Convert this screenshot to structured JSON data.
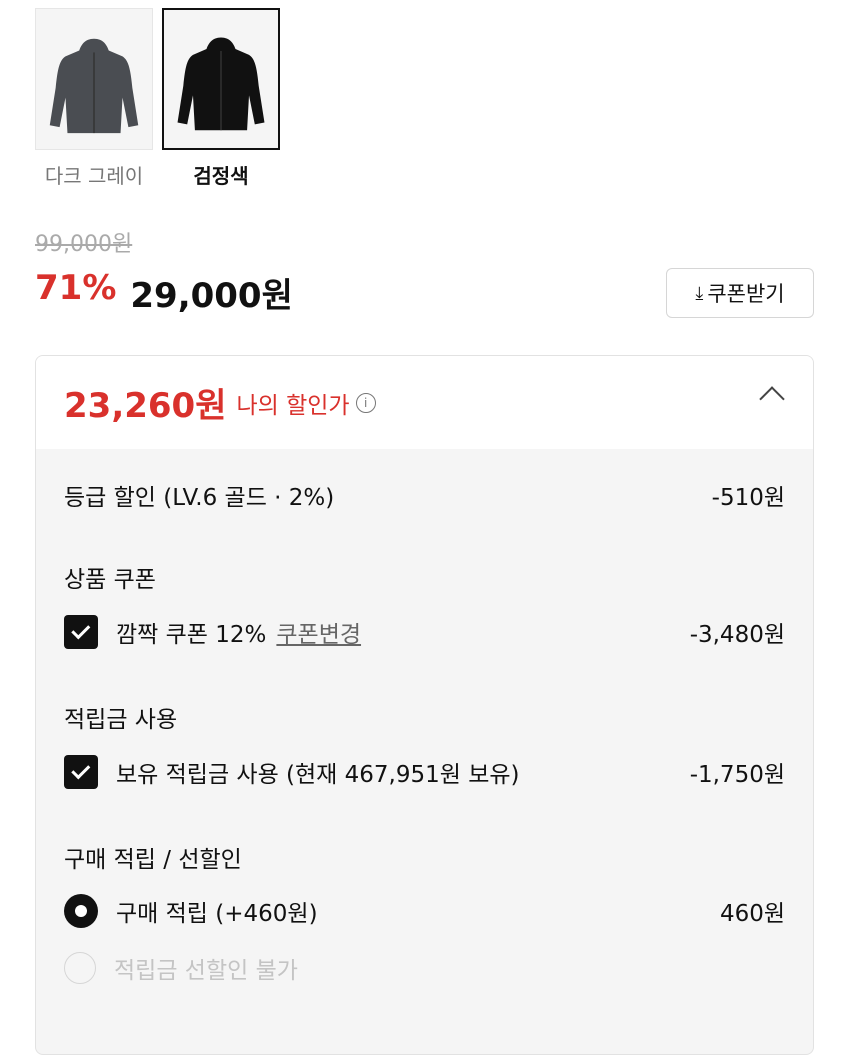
{
  "colors": {
    "swatches": [
      {
        "label": "다크 그레이",
        "color": "#4a4d52"
      },
      {
        "label": "검정색",
        "color": "#111111"
      }
    ]
  },
  "price": {
    "original": "99,000원",
    "discount_rate": "71%",
    "sale": "29,000원",
    "accent": "#d9312c"
  },
  "coupon_button": {
    "label": "쿠폰받기",
    "icon": "download-icon"
  },
  "my_discount": {
    "price": "23,260원",
    "label": "나의 할인가",
    "info_icon": "info-icon",
    "toggle_icon": "chevron-up-icon",
    "grade_discount": {
      "label": "등급 할인 (LV.6 골드 · 2%)",
      "amount": "-510원"
    },
    "product_coupon": {
      "title": "상품 쿠폰",
      "option_label": "깜짝 쿠폰 12%",
      "change_link": "쿠폰변경",
      "amount": "-3,480원",
      "checked": true
    },
    "points": {
      "title": "적립금 사용",
      "option_label": "보유 적립금 사용 (현재 467,951원 보유)",
      "amount": "-1,750원",
      "checked": true
    },
    "purchase": {
      "title": "구매 적립 / 선할인",
      "option_earn": "구매 적립 (+460원)",
      "earn_amount": "460원",
      "option_prediscount": "적립금 선할인 불가"
    }
  }
}
